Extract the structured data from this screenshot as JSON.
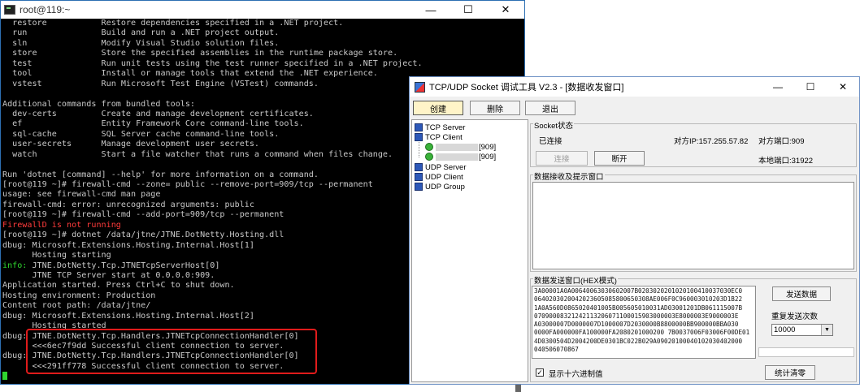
{
  "terminal": {
    "title": "root@119:~",
    "window_buttons": {
      "minimize": "—",
      "maximize": "☐",
      "close": "✕"
    },
    "lines": [
      {
        "text": "  restore           Restore dependencies specified in a .NET project.",
        "color": "normal"
      },
      {
        "text": "  run               Build and run a .NET project output.",
        "color": "normal"
      },
      {
        "text": "  sln               Modify Visual Studio solution files.",
        "color": "normal"
      },
      {
        "text": "  store             Store the specified assemblies in the runtime package store.",
        "color": "normal"
      },
      {
        "text": "  test              Run unit tests using the test runner specified in a .NET project.",
        "color": "normal"
      },
      {
        "text": "  tool              Install or manage tools that extend the .NET experience.",
        "color": "normal"
      },
      {
        "text": "  vstest            Run Microsoft Test Engine (VSTest) commands.",
        "color": "normal"
      },
      {
        "text": "",
        "color": "normal"
      },
      {
        "text": "Additional commands from bundled tools:",
        "color": "normal"
      },
      {
        "text": "  dev-certs         Create and manage development certificates.",
        "color": "normal"
      },
      {
        "text": "  ef                Entity Framework Core command-line tools.",
        "color": "normal"
      },
      {
        "text": "  sql-cache         SQL Server cache command-line tools.",
        "color": "normal"
      },
      {
        "text": "  user-secrets      Manage development user secrets.",
        "color": "normal"
      },
      {
        "text": "  watch             Start a file watcher that runs a command when files change.",
        "color": "normal"
      },
      {
        "text": "",
        "color": "normal"
      },
      {
        "text": "Run 'dotnet [command] --help' for more information on a command.",
        "color": "normal"
      },
      {
        "text": "[root@119 ~]# firewall-cmd --zone= public --remove-port=909/tcp --permanent",
        "color": "normal"
      },
      {
        "text": "usage: see firewall-cmd man page",
        "color": "normal"
      },
      {
        "text": "firewall-cmd: error: unrecognized arguments: public",
        "color": "normal"
      },
      {
        "text": "[root@119 ~]# firewall-cmd --add-port=909/tcp --permanent",
        "color": "normal"
      },
      {
        "text": "FirewallD is not running",
        "color": "red"
      },
      {
        "text": "[root@119 ~]# dotnet /data/jtne/JTNE.DotNetty.Hosting.dll",
        "color": "normal"
      },
      {
        "text": "dbug: Microsoft.Extensions.Hosting.Internal.Host[1]",
        "color": "normal"
      },
      {
        "text": "      Hosting starting",
        "color": "normal"
      },
      {
        "text": "info: JTNE.DotNetty.Tcp.JTNETcpServerHost[0]",
        "color": "info"
      },
      {
        "text": "      JTNE TCP Server start at 0.0.0.0:909.",
        "color": "normal"
      },
      {
        "text": "Application started. Press Ctrl+C to shut down.",
        "color": "normal"
      },
      {
        "text": "Hosting environment: Production",
        "color": "normal"
      },
      {
        "text": "Content root path: /data/jtne/",
        "color": "normal"
      },
      {
        "text": "dbug: Microsoft.Extensions.Hosting.Internal.Host[2]",
        "color": "normal"
      },
      {
        "text": "      Hosting started",
        "color": "normal"
      },
      {
        "text": "dbug: JTNE.DotNetty.Tcp.Handlers.JTNETcpConnectionHandler[0]",
        "color": "normal"
      },
      {
        "text": "      <<<6ec7f9dd Successful client connection to server.",
        "color": "normal"
      },
      {
        "text": "dbug: JTNE.DotNetty.Tcp.Handlers.JTNETcpConnectionHandler[0]",
        "color": "normal"
      },
      {
        "text": "      <<<291ff778 Successful client connection to server.",
        "color": "normal"
      },
      {
        "text": "",
        "color": "cursor"
      }
    ]
  },
  "socket_tool": {
    "title": "TCP/UDP Socket 调试工具 V2.3 - [数据收发窗口]",
    "window_buttons": {
      "minimize": "—",
      "maximize": "☐",
      "close": "✕"
    },
    "toolbar": {
      "create": "创建",
      "delete": "删除",
      "exit": "退出"
    },
    "tree": {
      "tcp_server": "TCP Server",
      "tcp_client": "TCP Client",
      "client_1_port": "[909]",
      "client_2_port": "[909]",
      "udp_server": "UDP Server",
      "udp_client": "UDP Client",
      "udp_group": "UDP Group"
    },
    "status": {
      "group_label": "Socket状态",
      "state": "已连接",
      "remote_ip": "对方IP:157.255.57.82",
      "remote_port": "对方端口:909",
      "local_port": "本地端口:31922",
      "connect_button": "连接",
      "disconnect_button": "断开"
    },
    "receive": {
      "group_label": "数据接收及提示窗口"
    },
    "send": {
      "group_label": "数据发送窗口(HEX模式)",
      "hex_lines": [
        "3A00001A0A00640063030602007B0203020201020100410037030EC0",
        "0640203020042023605085800650308AE006F0C960003010203D1B22",
        "1A0A560D0865020401005B005605010031AD03001201DB061115007B",
        "07090008321242113206071100015903000003E8000003E9000003E",
        "A03000007D0000007D1000007D2030000B8800000BB900000BBA030",
        "0000FA000000FA100000FA2080201000200 7B0037006F03006F00DE01",
        "4D0300504D2004200DE0301BC022B029A09020100040102030402000",
        "040506070867"
      ],
      "send_button": "发送数据",
      "repeat_label": "重复发送次数",
      "repeat_value": "10000",
      "hex_checkbox_label": "显示十六进制值",
      "hex_checked": true,
      "stats_button": "统计清零"
    }
  }
}
